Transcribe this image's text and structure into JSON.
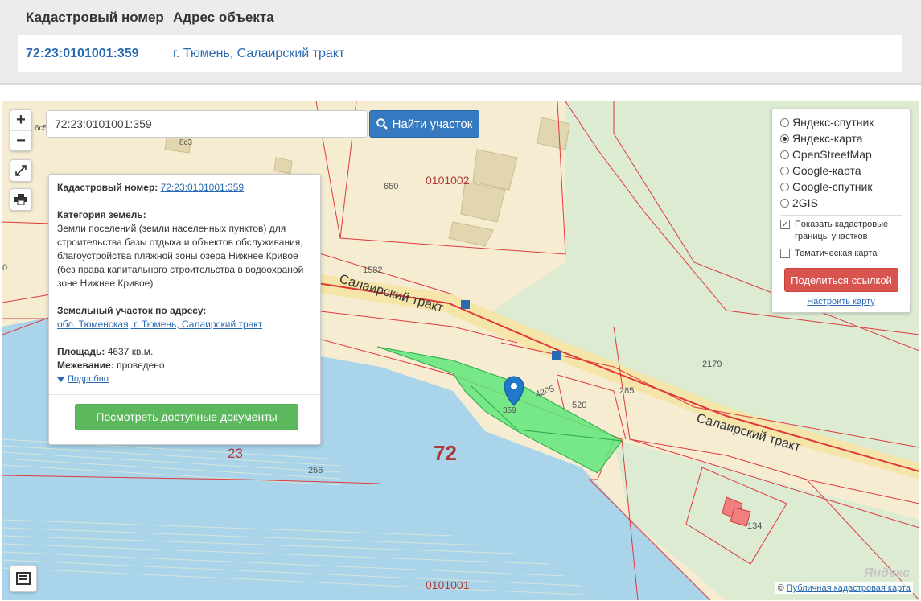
{
  "results": {
    "header": {
      "cadastral_number": "Кадастровый номер",
      "address": "Адрес объекта"
    },
    "rows": [
      {
        "cadastral_number": "72:23:0101001:359",
        "address": "г. Тюмень, Салаирский тракт"
      }
    ]
  },
  "map": {
    "zoom_in": "+",
    "zoom_out": "−",
    "search": {
      "value": "72:23:0101001:359",
      "button": "Найти участок"
    },
    "labels": {
      "road1": "Салаирский тракт",
      "road2": "Салаирский тракт",
      "quarter_a": "0101002",
      "quarter_b": "0101001",
      "district": "23",
      "region": "72",
      "n650": "650",
      "n1582": "1582",
      "n2179": "2179",
      "n4205": "4205",
      "n520": "520",
      "n285": "285",
      "n256": "256",
      "n359": "359",
      "n134": "134",
      "n8c3": "8с3",
      "n6c5": "6с5",
      "n0": "0"
    },
    "popup": {
      "cad_label": "Кадастровый номер:",
      "cad_value": "72:23:0101001:359",
      "category_label": "Категория земель:",
      "category_text": "Земли поселений (земли населенных пунктов) для строительства базы отдыха и объектов обслуживания, благоустройства пляжной зоны озера Нижнее Кривое (без права капитального строительства в водоохраной зоне Нижнее Кривое)",
      "address_label": "Земельный участок по адресу:",
      "address_value": "обл. Тюменская, г. Тюмень, Салаирский тракт",
      "area_label": "Площадь:",
      "area_value": "4637 кв.м.",
      "survey_label": "Межевание:",
      "survey_value": "проведено",
      "more": "Подробно",
      "docs_button": "Посмотреть доступные документы"
    },
    "layers": {
      "options": [
        {
          "label": "Яндекс-спутник",
          "selected": false
        },
        {
          "label": "Яндекс-карта",
          "selected": true
        },
        {
          "label": "OpenStreetMap",
          "selected": false
        },
        {
          "label": "Google-карта",
          "selected": false
        },
        {
          "label": "Google-спутник",
          "selected": false
        },
        {
          "label": "2GIS",
          "selected": false
        }
      ],
      "show_borders": {
        "label": "Показать кадастровые границы участков",
        "checked": true
      },
      "thematic": {
        "label": "Тематическая карта",
        "checked": false
      },
      "share": "Поделиться ссылкой",
      "configure": "Настроить карту"
    },
    "attribution": {
      "symbol": "©",
      "link": "Публичная кадастровая карта"
    },
    "logo": "Яндекс",
    "colors": {
      "parcel": "#5fe87a",
      "water": "#a9d4ea",
      "border": "#e0393b",
      "road": "#f6e5a8",
      "land": "#f5ecd2",
      "green": "#d9ecd4"
    }
  }
}
